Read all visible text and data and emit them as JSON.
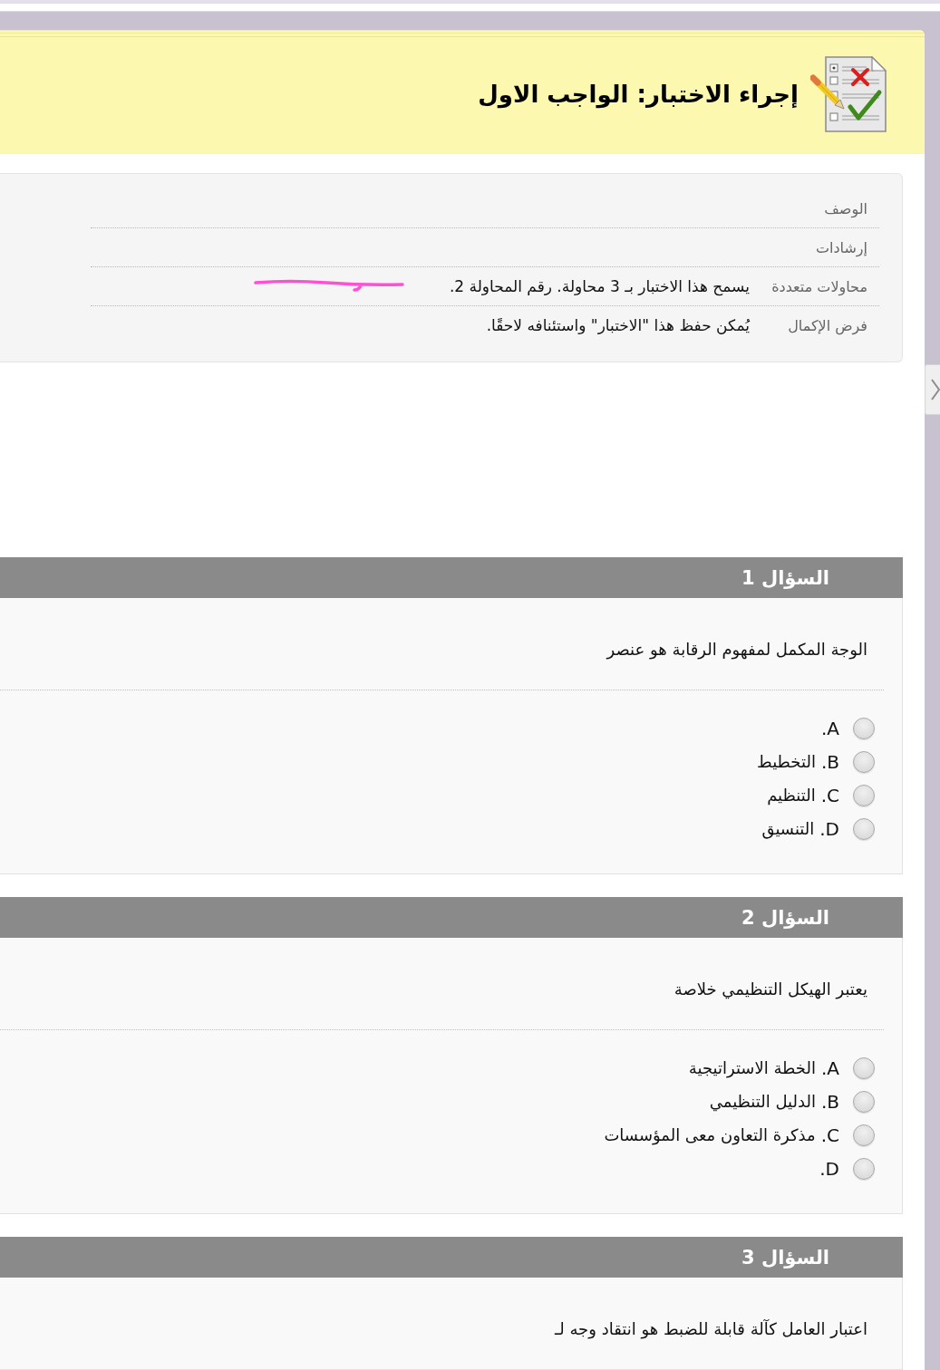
{
  "page_header": {
    "title": "إجراء الاختبار: الواجب الاول"
  },
  "details": [
    {
      "label": "الوصف"
    },
    {
      "label": "إرشادات"
    },
    {
      "label": "محاولات متعددة",
      "value": "يسمح هذا الاختبار بـ 3 محاولة. رقم المحاولة 2."
    },
    {
      "label": "فرض الإكمال",
      "value": "يُمكن حفظ هذا \"الاختبار\" واستئنافه لاحقًا."
    }
  ],
  "questions": [
    {
      "heading": "السؤال 1",
      "text": "الوجة المكمل لمفهوم الرقابة هو عنصر",
      "options": [
        {
          "letter": "A.",
          "selected": false
        },
        {
          "letter": "B.",
          "text": "التخطيط",
          "selected": false
        },
        {
          "letter": "C.",
          "text": "التنظيم",
          "selected": false
        },
        {
          "letter": "D.",
          "text": "التنسيق",
          "selected": false
        }
      ]
    },
    {
      "heading": "السؤال 2",
      "text": "يعتبر الهيكل التنظيمي خلاصة",
      "options": [
        {
          "letter": "A.",
          "text": "الخطة الاستراتيجية",
          "selected": false
        },
        {
          "letter": "B.",
          "text": "الدليل التنظيمي",
          "selected": false
        },
        {
          "letter": "C.",
          "text": "مذكرة التعاون معى المؤسسات",
          "selected": false
        },
        {
          "letter": "D.",
          "selected": false
        }
      ]
    },
    {
      "heading": "السؤال 3",
      "text": "اعتبار العامل كآلة قابلة للضبط هو انتقاد وجه لـ"
    }
  ]
}
